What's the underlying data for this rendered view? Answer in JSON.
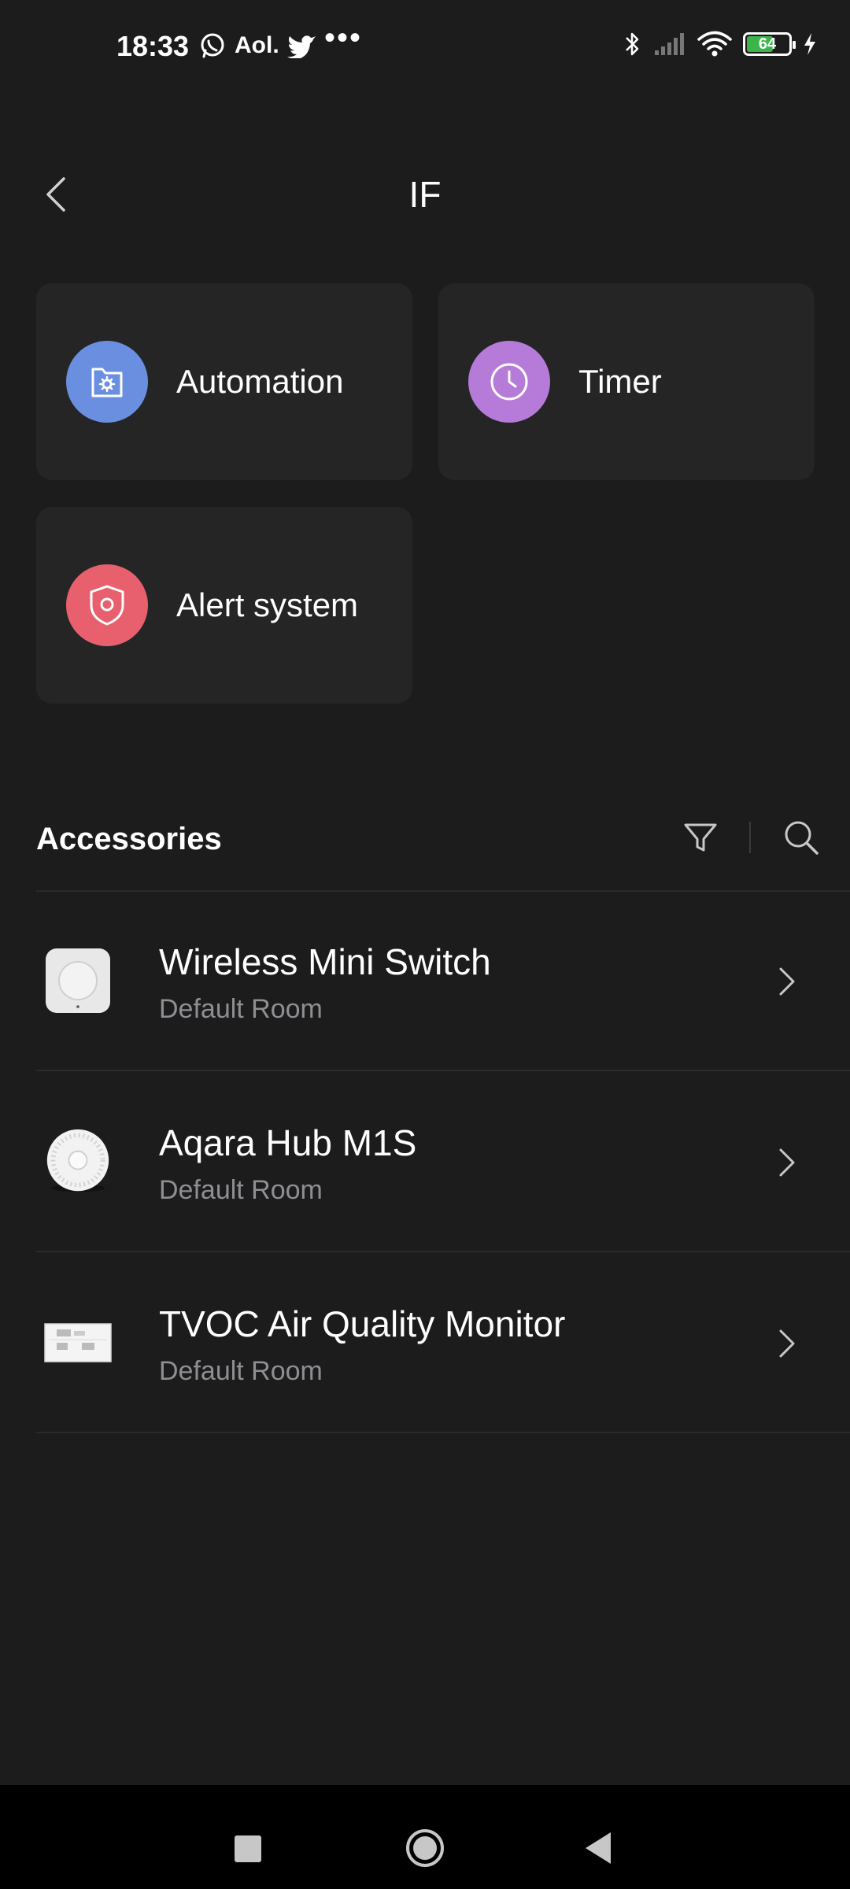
{
  "status_bar": {
    "time": "18:33",
    "app_badge_aol": "Aol.",
    "more_dots": "•••",
    "battery_level": "64",
    "battery_fraction": 0.64,
    "battery_color": "#3bb54a"
  },
  "header": {
    "title": "IF"
  },
  "cards": [
    {
      "label": "Automation",
      "icon": "automation-icon",
      "color": "#6b8fe0"
    },
    {
      "label": "Timer",
      "icon": "clock-icon",
      "color": "#b67ad8"
    },
    {
      "label": "Alert system",
      "icon": "shield-icon",
      "color": "#e8606d"
    }
  ],
  "accessories": {
    "title": "Accessories",
    "items": [
      {
        "name": "Wireless Mini Switch",
        "room": "Default Room",
        "icon": "wireless-switch-thumbnail"
      },
      {
        "name": "Aqara Hub M1S",
        "room": "Default Room",
        "icon": "hub-thumbnail"
      },
      {
        "name": "TVOC Air Quality Monitor",
        "room": "Default Room",
        "icon": "air-monitor-thumbnail"
      }
    ]
  }
}
